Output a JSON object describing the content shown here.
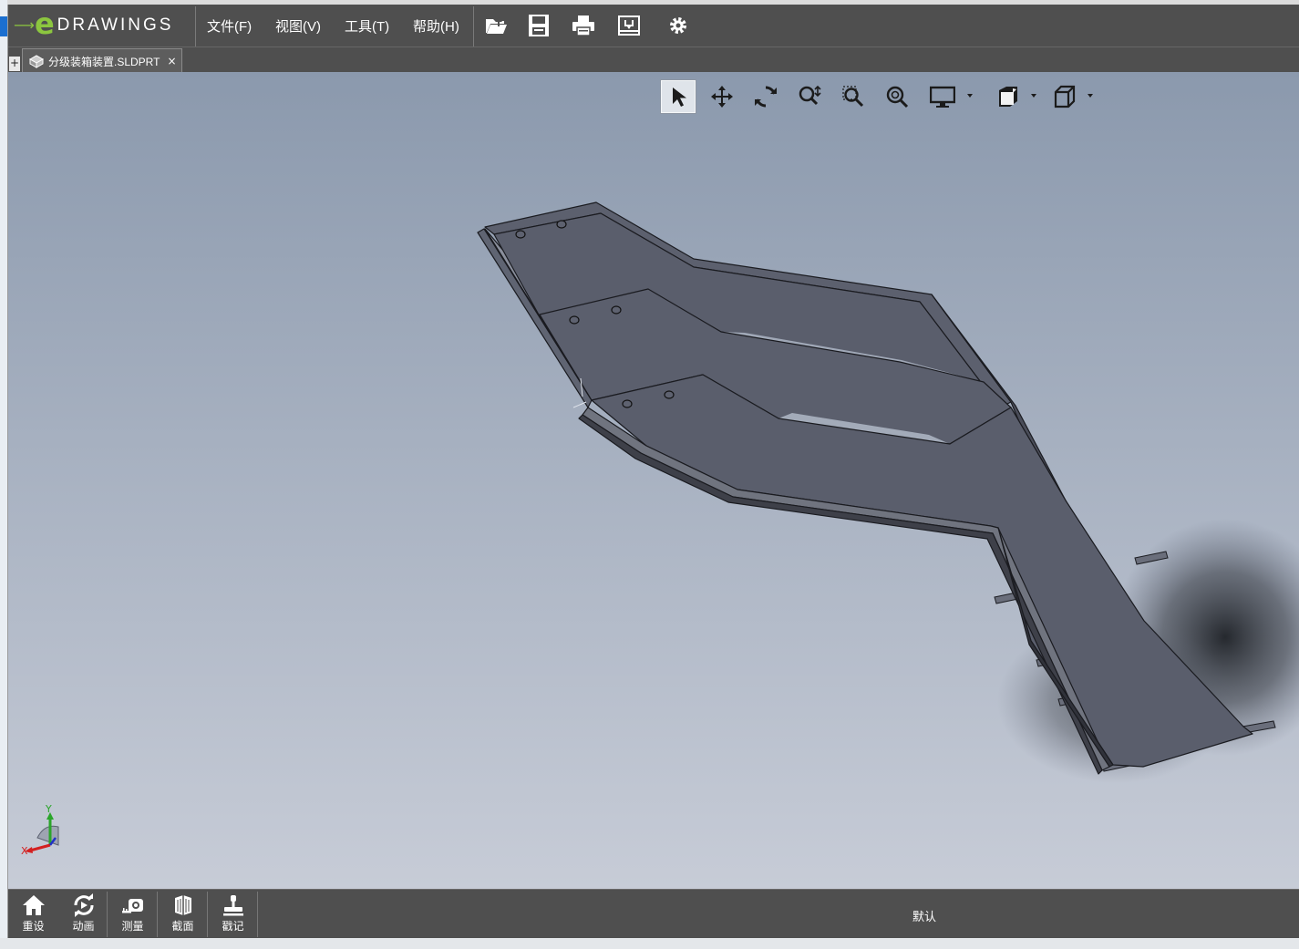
{
  "app": {
    "logo_text": "DRAWINGS",
    "logo_letter": "e"
  },
  "menu": {
    "items": [
      {
        "label": "文件(F)"
      },
      {
        "label": "视图(V)"
      },
      {
        "label": "工具(T)"
      },
      {
        "label": "帮助(H)"
      }
    ]
  },
  "toolbar": {
    "icons": [
      "open-icon",
      "save-icon",
      "print-icon",
      "publish-icon",
      "settings-icon"
    ]
  },
  "tabs": {
    "add_label": "+",
    "document": {
      "label": "分级装箱装置.SLDPRT",
      "close_label": "×",
      "icon": "part-icon"
    }
  },
  "view_toolbar": {
    "icons": [
      "select-icon",
      "pan-icon",
      "rotate-icon",
      "zoom-icon",
      "zoom-to-area-icon",
      "zoom-to-fit-icon",
      "display-style-icon",
      "view-orientation-icon",
      "standard-views-icon"
    ],
    "active": "select-icon"
  },
  "triad": {
    "x_label": "X",
    "y_label": "Y"
  },
  "bottom_bar": {
    "buttons": [
      {
        "label": "重设",
        "icon": "home-icon"
      },
      {
        "label": "动画",
        "icon": "animate-icon"
      },
      {
        "label": "测量",
        "icon": "measure-icon"
      },
      {
        "label": "截面",
        "icon": "section-icon"
      },
      {
        "label": "戳记",
        "icon": "stamp-icon"
      }
    ],
    "configuration": "默认"
  },
  "colors": {
    "chrome": "#4f4f4f",
    "accent": "#8cc63f",
    "model_face": "#5b5f6d",
    "viewport_top": "#8b99ad",
    "viewport_bottom": "#c7ccd7"
  }
}
